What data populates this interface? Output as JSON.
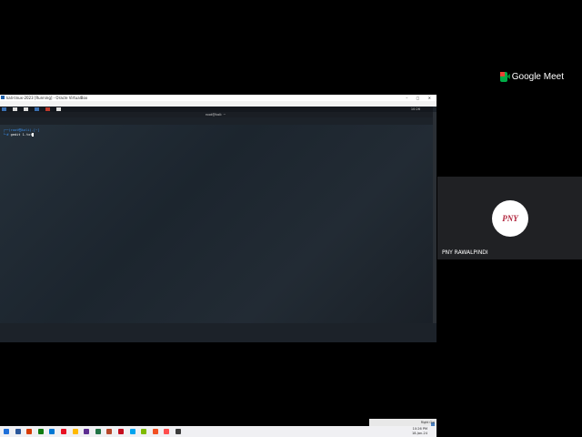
{
  "meet": {
    "logo_text": "Google Meet",
    "participant": {
      "name": "PNY RAWALPINDI",
      "avatar_text": "PNY"
    }
  },
  "virtualbox": {
    "title": "kali-linux-2023 [Running] - Oracle VirtualBox",
    "menu": [
      "File",
      "Machine",
      "View",
      "Input",
      "Devices",
      "Help"
    ],
    "status_key": "Right Ctrl"
  },
  "kali": {
    "clock": "10:26",
    "terminal_title": "root@kali: ~",
    "terminal_menu": [
      "Session",
      "Actions",
      "Edit",
      "View",
      "Help"
    ],
    "prompt_line1": "┌──(root㉿kali)-[~]",
    "prompt_line2": "└─# ",
    "command": "gedit 1.txt"
  },
  "windows": {
    "tray_time": "10:26 PM",
    "tray_date": "18-Jan-24",
    "taskbar_colors": [
      "#1e6fd9",
      "#2b579a",
      "#d83b01",
      "#107c10",
      "#0078d4",
      "#e81123",
      "#ffb900",
      "#5c2d91",
      "#217346",
      "#b7472a",
      "#c50f1f",
      "#00a4ef",
      "#7fba00",
      "#f25022",
      "#ff4d4d",
      "#3c3c3c"
    ]
  }
}
